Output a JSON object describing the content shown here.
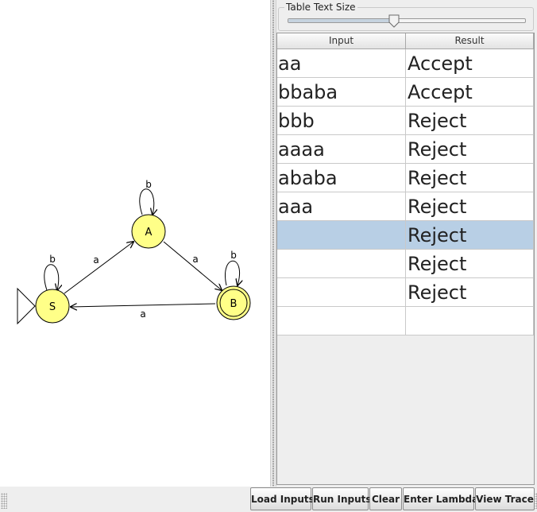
{
  "automaton": {
    "states": [
      {
        "id": "S",
        "label": "S",
        "initial": true,
        "final": false
      },
      {
        "id": "A",
        "label": "A",
        "initial": false,
        "final": false
      },
      {
        "id": "B",
        "label": "B",
        "initial": false,
        "final": true
      }
    ],
    "transitions": [
      {
        "from": "S",
        "to": "S",
        "label": "b"
      },
      {
        "from": "S",
        "to": "A",
        "label": "a"
      },
      {
        "from": "A",
        "to": "A",
        "label": "b"
      },
      {
        "from": "A",
        "to": "B",
        "label": "a"
      },
      {
        "from": "B",
        "to": "B",
        "label": "b"
      },
      {
        "from": "B",
        "to": "S",
        "label": "a"
      }
    ],
    "state_color": "#ffff88"
  },
  "text_size": {
    "title": "Table Text Size",
    "value": 0.45
  },
  "table": {
    "headers": {
      "input": "Input",
      "result": "Result"
    },
    "rows": [
      {
        "input": "aa",
        "result": "Accept"
      },
      {
        "input": "bbaba",
        "result": "Accept"
      },
      {
        "input": "bbb",
        "result": "Reject"
      },
      {
        "input": "aaaa",
        "result": "Reject"
      },
      {
        "input": "ababa",
        "result": "Reject"
      },
      {
        "input": "aaa",
        "result": "Reject"
      },
      {
        "input": "",
        "result": "Reject"
      },
      {
        "input": "",
        "result": "Reject"
      },
      {
        "input": "",
        "result": "Reject"
      },
      {
        "input": "",
        "result": ""
      }
    ],
    "selected_row": 6,
    "selection_color": "#b8cfe5"
  },
  "buttons": {
    "load": "Load Inputs",
    "run": "Run Inputs",
    "clear": "Clear",
    "lambda": "Enter Lambda",
    "trace": "View Trace"
  }
}
